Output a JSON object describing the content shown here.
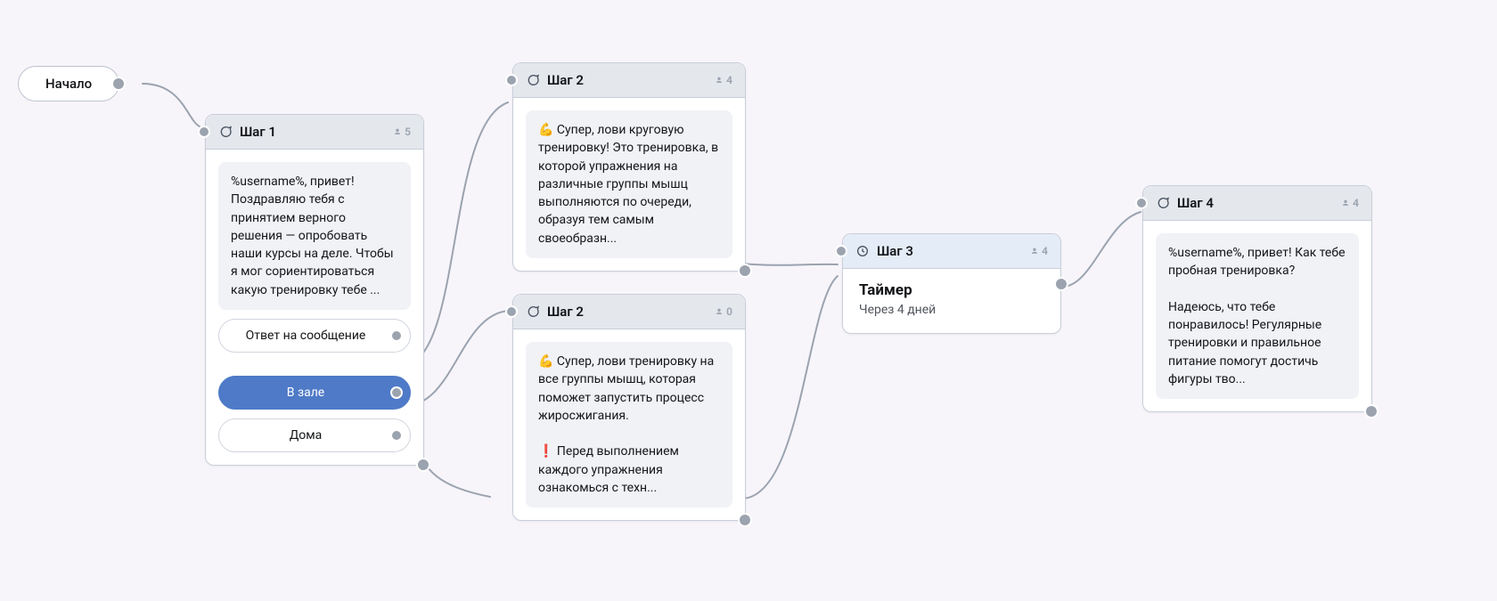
{
  "start": {
    "label": "Начало"
  },
  "steps": {
    "step1": {
      "title": "Шаг 1",
      "count": 5,
      "message": "%username%, привет! Поздравляю тебя с принятием верного решения — опробовать наши курсы на деле. Чтобы я мог сориентироваться какую тренировку тебе ...",
      "options": [
        {
          "label": "Ответ на сообщение",
          "active": false
        },
        {
          "label": "В зале",
          "active": true
        },
        {
          "label": "Дома",
          "active": false
        }
      ]
    },
    "step2a": {
      "title": "Шаг 2",
      "count": 4,
      "message": "💪 Супер, лови круговую тренировку! Это тренировка, в которой упражнения на различные группы мышц выполняются по очереди, образуя тем самым своеобразн..."
    },
    "step2b": {
      "title": "Шаг 2",
      "count": 0,
      "message": "💪  Супер, лови тренировку на все группы мышц, которая поможет запустить процесс жиросжигания.\n\n❗ Перед выполнением каждого упражнения ознакомься с техн..."
    },
    "step3": {
      "title": "Шаг 3",
      "count": 4,
      "timer_title": "Таймер",
      "timer_sub": "Через 4 дней"
    },
    "step4": {
      "title": "Шаг 4",
      "count": 4,
      "message": "%username%, привет! Как тебе пробная тренировка?\n\nНадеюсь, что тебе понравилось! Регулярные тренировки и правильное питание помогут достичь фигуры тво..."
    }
  }
}
